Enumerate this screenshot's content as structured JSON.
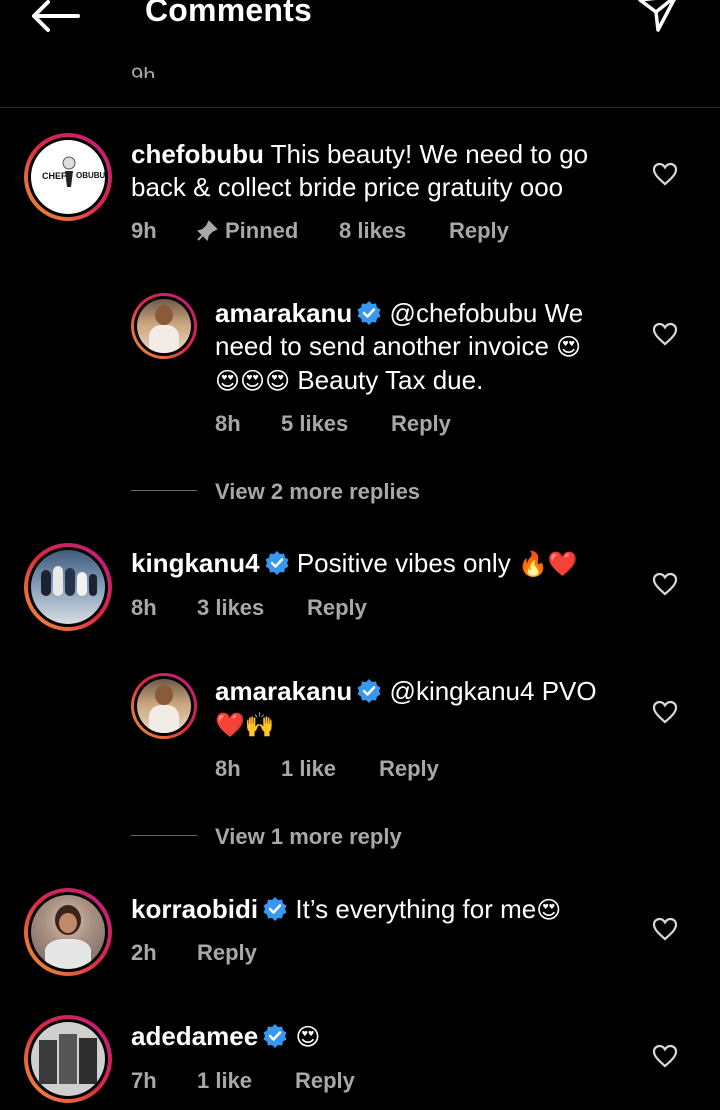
{
  "header": {
    "title": "Comments",
    "partial_time": "9h"
  },
  "comments": [
    {
      "username": "chefobubu",
      "text_line1": "This beauty! We need to go",
      "text_line2": "back & collect bride price gratuity ooo",
      "time": "9h",
      "pinned": "Pinned",
      "likes": "8 likes",
      "reply": "Reply",
      "avatar_text_left": "CHEF",
      "avatar_text_right": "OBUBU",
      "replies": [
        {
          "username": "amarakanu",
          "mention": "@chefobubu",
          "text_line1_end": "We",
          "text_line2": "need to send another invoice",
          "text_line3": "Beauty Tax due.",
          "time": "8h",
          "likes": "5 likes",
          "reply": "Reply"
        }
      ],
      "view_more": "View 2 more replies"
    },
    {
      "username": "kingkanu4",
      "text": "Positive vibes only",
      "time": "8h",
      "likes": "3 likes",
      "reply": "Reply",
      "replies": [
        {
          "username": "amarakanu",
          "mention": "@kingkanu4",
          "text": "PVO",
          "time": "8h",
          "likes": "1 like",
          "reply": "Reply"
        }
      ],
      "view_more": "View 1 more reply"
    },
    {
      "username": "korraobidi",
      "text": "It’s everything for me",
      "time": "2h",
      "reply": "Reply"
    },
    {
      "username": "adedamee",
      "time": "7h",
      "likes": "1 like",
      "reply": "Reply"
    }
  ],
  "emoji": {
    "heart_eyes": "😍",
    "fire": "🔥",
    "red_heart": "❤️",
    "raised_hands": "🙌"
  },
  "colors": {
    "background": "#000000",
    "secondary_text": "#a8a8a8",
    "verified": "#3897f0"
  }
}
